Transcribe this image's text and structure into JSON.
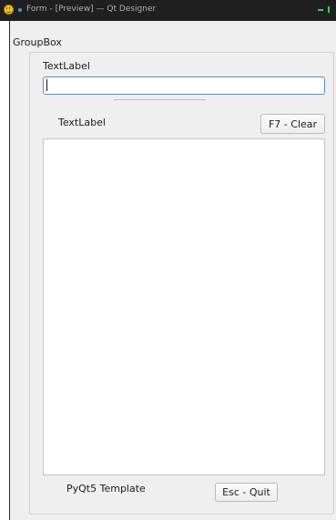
{
  "window": {
    "title": "Form - [Preview] — Qt Designer",
    "app_icon": "qt-designer-smiley-icon",
    "controls": [
      "minimize-icon",
      "maximize-icon"
    ]
  },
  "colors": {
    "titlebar_bg": "#1f1f1f",
    "client_bg": "#efefef",
    "focus_border": "#5a8fc4",
    "window_controls": "#2fd15a"
  },
  "form": {
    "groupbox_title": "GroupBox",
    "top_label": "TextLabel",
    "line_edit_value": "",
    "mid_label": "TextLabel",
    "clear_button_label": "F7 - Clear",
    "text_area_value": "",
    "bottom_label": "PyQt5 Template",
    "quit_button_label": "Esc - Quit"
  }
}
